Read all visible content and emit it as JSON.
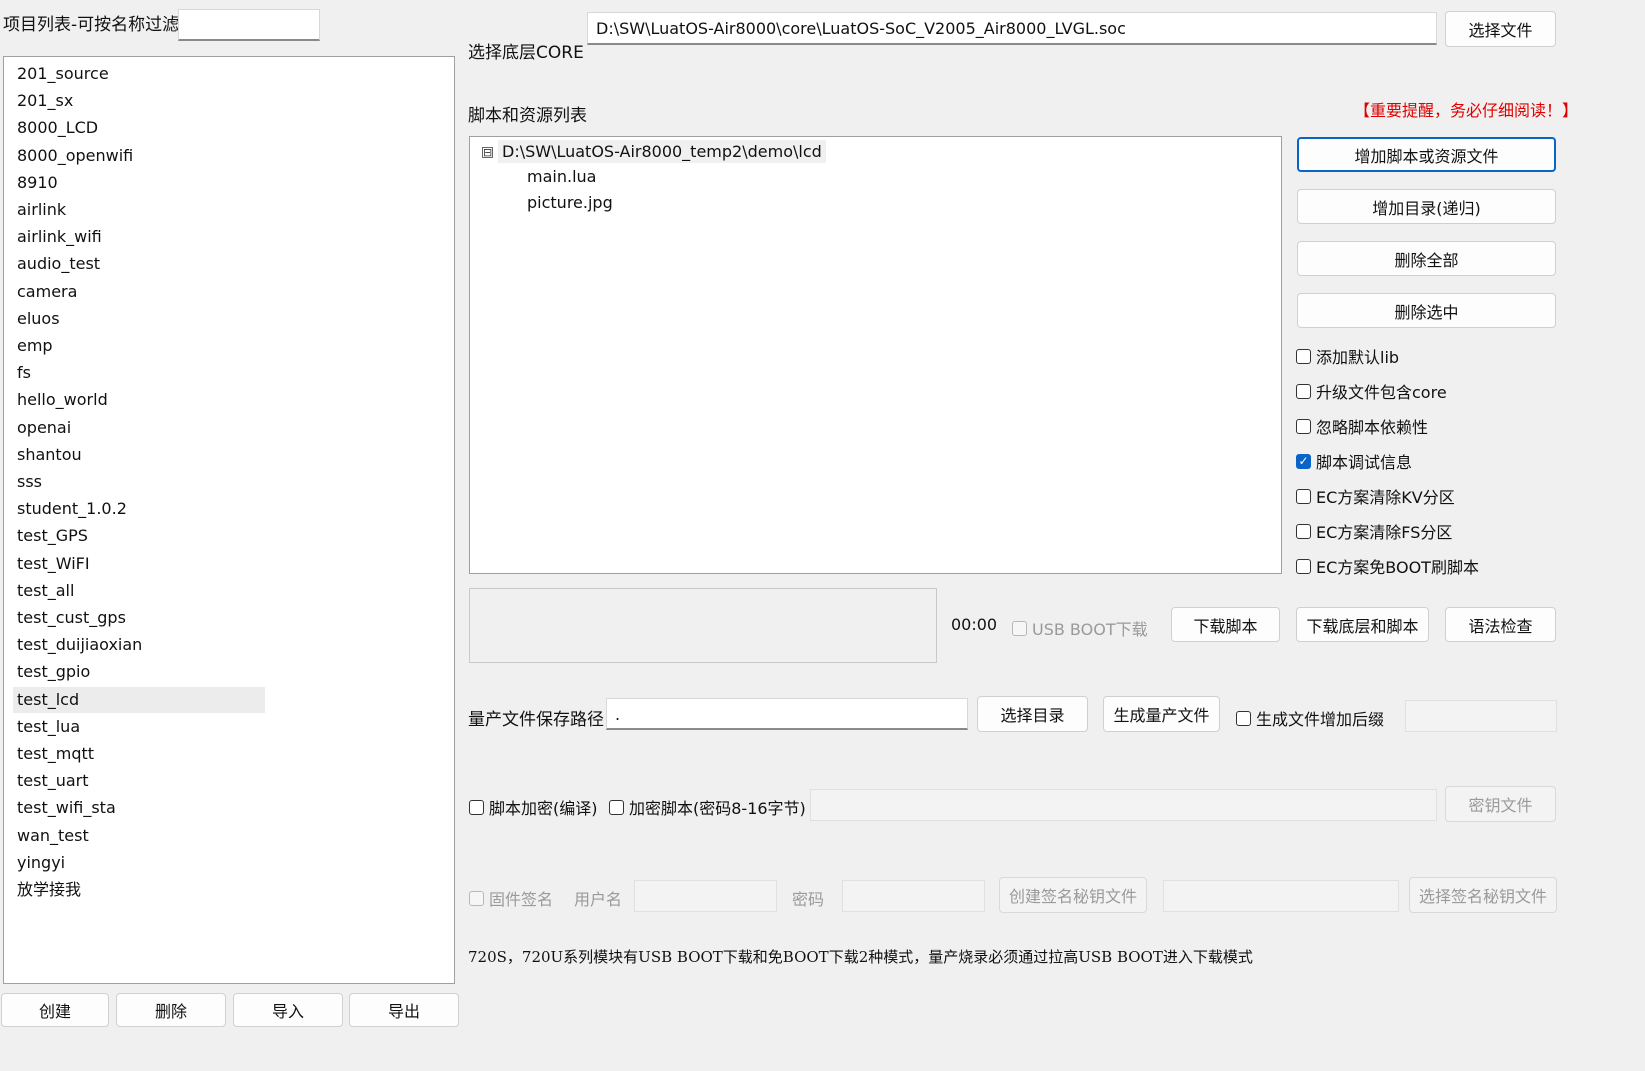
{
  "left": {
    "filter_label": "项目列表-可按名称过滤",
    "filter_value": "",
    "projects": [
      "201_source",
      "201_sx",
      "8000_LCD",
      "8000_openwifi",
      "8910",
      "airlink",
      "airlink_wifi",
      "audio_test",
      "camera",
      "eluos",
      "emp",
      "fs",
      "hello_world",
      "openai",
      "shantou",
      "sss",
      "student_1.0.2",
      "test_GPS",
      "test_WiFI",
      "test_all",
      "test_cust_gps",
      "test_duijiaoxian",
      "test_gpio",
      "test_lcd",
      "test_lua",
      "test_mqtt",
      "test_uart",
      "test_wifi_sta",
      "wan_test",
      "yingyi",
      "放学接我"
    ],
    "selected_project": "test_lcd",
    "buttons": {
      "create": "创建",
      "delete": "删除",
      "import": "导入",
      "export": "导出"
    }
  },
  "core": {
    "label": "选择底层CORE",
    "path": "D:\\SW\\LuatOS-Air8000\\core\\LuatOS-SoC_V2005_Air8000_LVGL.soc",
    "select_file_button": "选择文件"
  },
  "scripts": {
    "label": "脚本和资源列表",
    "warning": "【重要提醒，务必仔细阅读！】",
    "tree_root": "D:\\SW\\LuatOS-Air8000_temp2\\demo\\lcd",
    "tree_toggle": "⊟",
    "files": [
      "main.lua",
      "picture.jpg"
    ],
    "buttons": {
      "add_files": "增加脚本或资源文件",
      "add_dir": "增加目录(递归)",
      "delete_all": "删除全部",
      "delete_selected": "删除选中"
    },
    "options": {
      "add_default_lib": "添加默认lib",
      "upgrade_include_core": "升级文件包含core",
      "ignore_dependency": "忽略脚本依赖性",
      "script_debug_info": "脚本调试信息",
      "ec_clear_kv": "EC方案清除KV分区",
      "ec_clear_fs": "EC方案清除FS分区",
      "ec_no_boot": "EC方案免BOOT刷脚本"
    }
  },
  "download": {
    "timer": "00:00",
    "usb_boot": "USB BOOT下载",
    "download_script": "下载脚本",
    "download_core_and_script": "下载底层和脚本",
    "syntax_check": "语法检查"
  },
  "mass": {
    "path_label": "量产文件保存路径",
    "path_value": ".",
    "select_dir": "选择目录",
    "generate": "生成量产文件",
    "add_suffix": "生成文件增加后缀",
    "suffix_value": ""
  },
  "encrypt": {
    "compile_encrypt": "脚本加密(编译)",
    "password_encrypt": "加密脚本(密码8-16字节)",
    "key_value": "",
    "key_file": "密钥文件"
  },
  "sign": {
    "firmware_sign": "固件签名",
    "username_label": "用户名",
    "password_label": "密码",
    "create_key_file": "创建签名秘钥文件",
    "select_key_file": "选择签名秘钥文件"
  },
  "footer_note": "720S，720U系列模块有USB BOOT下载和免BOOT下载2种模式，量产烧录必须通过拉高USB BOOT进入下载模式",
  "icons": {
    "check": "✓"
  }
}
